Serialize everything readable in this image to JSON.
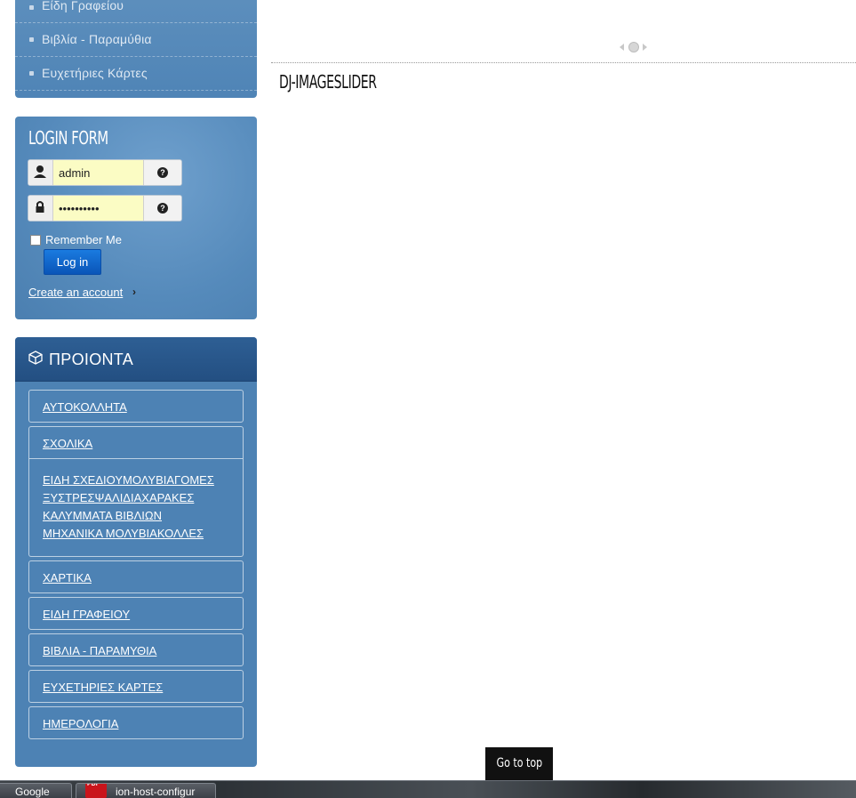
{
  "top_menu": {
    "items": [
      {
        "label": "Είδη Γραφείου"
      },
      {
        "label": "Βιβλία - Παραμύθια"
      },
      {
        "label": "Ευχετήριες Κάρτες"
      }
    ]
  },
  "login": {
    "title": "LOGIN FORM",
    "username_value": "admin",
    "password_value": "••••••••••",
    "remember_label": "Remember Me",
    "button_label": "Log in",
    "create_account_label": "Create an account",
    "help_glyph": "?"
  },
  "products": {
    "title": "ΠΡΟΙΟΝΤΑ",
    "items": [
      {
        "label": "ΑΥΤΟΚΟΛΛΗΤΑ"
      },
      {
        "label": "ΣΧΟΛΙΚΑ"
      },
      {
        "label": "ΧΑΡΤΙΚΑ"
      },
      {
        "label": "ΕΙΔΗ ΓΡΑΦΕΙΟΥ"
      },
      {
        "label": "ΒΙΒΛΙΑ - ΠΑΡΑΜΥΘΙΑ"
      },
      {
        "label": "ΕΥΧΕΤΗΡΙΕΣ ΚΑΡΤΕΣ"
      },
      {
        "label": "ΗΜΕΡΟΛΟΓΙΑ"
      }
    ],
    "sub_items": [
      {
        "label": "ΕΙΔΗ ΣΧΕΔΙΟΥΜΟΛΥΒΙΑΓΟΜΕΣ"
      },
      {
        "label": "ΞΥΣΤΡΕΣΨΑΛΙΔΙΑΧΑΡΑΚΕΣ"
      },
      {
        "label": "ΚΑΛΥΜΜΑΤΑ ΒΙΒΛΙΩΝ"
      },
      {
        "label": "ΜΗΧΑΝΙΚΑ ΜΟΛΥΒΙΑΚΟΛΛΕΣ"
      }
    ]
  },
  "main": {
    "module_title": "DJ-IMAGESLIDER",
    "go_top_label": "Go to top"
  },
  "taskbar": {
    "items": [
      {
        "label": "Google"
      },
      {
        "label": "ion-host-configur"
      }
    ],
    "pdf_badge": "PDF"
  },
  "colors": {
    "panel_blue": "#5588b9",
    "header_dark_blue": "#2a5a8e",
    "login_button": "#1466cc",
    "field_yellow": "#fbfcc4"
  }
}
